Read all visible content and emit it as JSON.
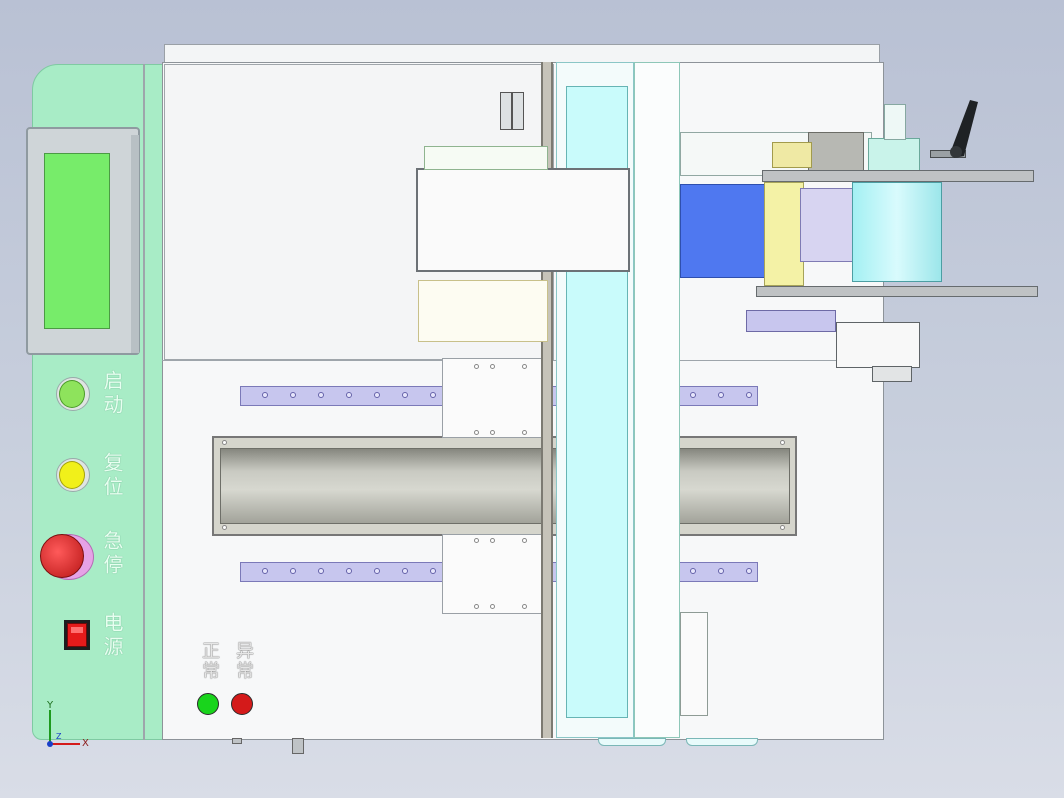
{
  "panel": {
    "start_label": "启动",
    "reset_label": "复位",
    "estop_label": "急停",
    "power_label": "电源"
  },
  "status": {
    "normal_label": "正常",
    "abnormal_label": "异常"
  },
  "axes": {
    "y_label": "Y",
    "x_label": "X",
    "z_label": "Z"
  },
  "colors": {
    "panel_bg": "#a8ecc6",
    "hmi_screen": "#77ec6a",
    "start_button": "#8ee35c",
    "reset_button": "#f1f01a",
    "estop_button": "#d92222",
    "normal_light": "#19d41c",
    "abnormal_light": "#d41a1a",
    "belt_blue": "#4f78f0",
    "rail_purple": "#c7c6ee",
    "cyan_part": "#c9fbfb"
  }
}
